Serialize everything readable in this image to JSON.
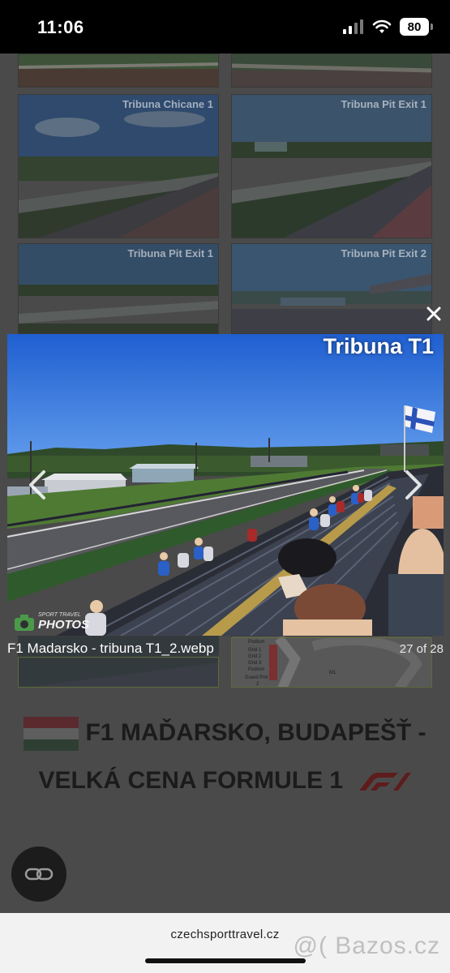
{
  "status_bar": {
    "time": "11:06",
    "battery": "80"
  },
  "gallery": {
    "thumbnails": [
      {
        "label": "Tribuna Chicane 1"
      },
      {
        "label": "Tribuna Pit Exit 1"
      },
      {
        "label": "Tribuna Pit Exit 1"
      },
      {
        "label": "Tribuna Pit Exit 2"
      }
    ]
  },
  "lightbox": {
    "image_title": "Tribuna T1",
    "watermark_top": "SPORT TRAVEL",
    "watermark": "PHOTOS",
    "filename": "F1 Madarsko - tribuna T1_2.webp",
    "counter": "27 of 28"
  },
  "map_labels": {
    "podium_a": "Podium",
    "grid_1": "Grid 1",
    "grid_2": "Grid 2",
    "grid_3": "Grid 3",
    "podium_b": "Podium",
    "grand_prix": "Grand Prix",
    "grand_prix_num": "2"
  },
  "page": {
    "heading_line1": "F1 MAĎARSKO, BUDAPEŠŤ -",
    "heading_line2": "VELKÁ CENA FORMULE 1"
  },
  "browser": {
    "url": "czechsporttravel.cz",
    "watermark": "@( Bazos.cz"
  },
  "colors": {
    "sky": "#2f6fd6",
    "flag_red": "#cd2a3e",
    "flag_white": "#ffffff",
    "flag_green": "#436f4d",
    "f1_red": "#e10600"
  }
}
